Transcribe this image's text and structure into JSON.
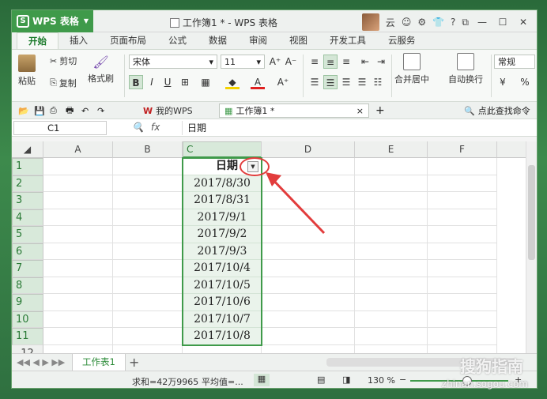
{
  "app": {
    "name": "WPS 表格",
    "title": "工作簿1 * - WPS 表格",
    "user": "云"
  },
  "ribbon_tabs": [
    "开始",
    "插入",
    "页面布局",
    "公式",
    "数据",
    "审阅",
    "视图",
    "开发工具",
    "云服务"
  ],
  "ribbon": {
    "paste": "粘贴",
    "cut": "剪切",
    "copy": "复制",
    "format_painter": "格式刷",
    "font_name": "宋体",
    "font_size": "11",
    "merge_center": "合并居中",
    "wrap_text": "自动换行",
    "number_format": "常规"
  },
  "quick_tabs": {
    "my_wps": "我的WPS",
    "workbook": "工作簿1 *",
    "search": "点此查找命令"
  },
  "formula_bar": {
    "name_box": "C1",
    "fx": "fx",
    "value": "日期"
  },
  "columns": [
    "A",
    "B",
    "C",
    "D",
    "E",
    "F"
  ],
  "rows": [
    "1",
    "2",
    "3",
    "4",
    "5",
    "6",
    "7",
    "8",
    "9",
    "10",
    "11",
    "12"
  ],
  "column_c": [
    "日期",
    "2017/8/30",
    "2017/8/31",
    "2017/9/1",
    "2017/9/2",
    "2017/9/3",
    "2017/10/4",
    "2017/10/5",
    "2017/10/6",
    "2017/10/7",
    "2017/10/8"
  ],
  "sheet_tab": "工作表1",
  "status": {
    "sum": "求和=42万9965",
    "avg": "平均值=...",
    "zoom": "130 %"
  },
  "watermark": {
    "brand": "搜狗指南",
    "url": "zhinan.sogou.com"
  },
  "colors": {
    "accent": "#3f9a4a",
    "annotation": "#e23c3c"
  }
}
